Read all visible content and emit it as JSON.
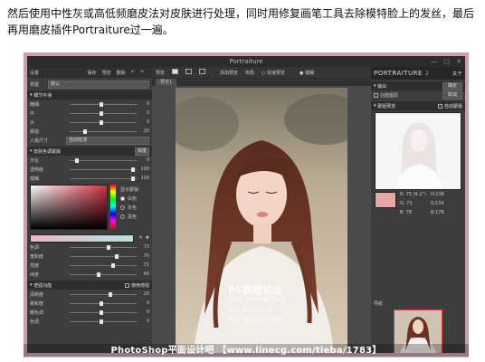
{
  "intro": {
    "line1": "然后使用中性灰或高低频磨皮法对皮肤进行处理，同时用修复画笔工具去除模特脸上的发丝，最后",
    "line2": "再用磨皮插件Portraiture过一遍。"
  },
  "window": {
    "title": "Portraiture",
    "controls": [
      "—",
      "□",
      "✕"
    ]
  },
  "left_panel": {
    "header": [
      "设置",
      "保存",
      "预览",
      "删除"
    ],
    "preset_label": "预置",
    "preset_value": "默认",
    "detail_section": "细节平滑",
    "detail_sliders": [
      {
        "label": "精细",
        "value": "0"
      },
      {
        "label": "中",
        "value": "0"
      },
      {
        "label": "大",
        "value": "0"
      },
      {
        "label": "阈值",
        "value": "20"
      }
    ],
    "portrait_size_label": "人像尺寸",
    "portrait_size_value": "自动检测",
    "mask_section": "皮肤色调蒙版",
    "mask_section_value": "高度",
    "mask_sliders": [
      {
        "label": "日化",
        "value": "0"
      },
      {
        "label": "透明度",
        "value": "100"
      },
      {
        "label": "模糊",
        "value": "100"
      }
    ],
    "display_mask": "显示蒙版",
    "mask_options": [
      "白色",
      "灰色",
      "黑色"
    ],
    "hue_sliders": [
      {
        "label": "色调",
        "value": "73"
      },
      {
        "label": "宽和度",
        "value": "70"
      },
      {
        "label": "亮度",
        "value": "71"
      },
      {
        "label": "纬度",
        "value": "40"
      }
    ],
    "enhance_section": "增强功能",
    "enhance_check": "使用增强",
    "enhance_sliders": [
      {
        "label": "清晰度",
        "value": "20"
      },
      {
        "label": "柔和度",
        "value": "0"
      },
      {
        "label": "暖色调",
        "value": "0"
      },
      {
        "label": "色调",
        "value": "0"
      }
    ]
  },
  "center_panel": {
    "toolbar": [
      "预览",
      "添加预览",
      "布局",
      "快速预览",
      "模糊"
    ],
    "tab": "预览1"
  },
  "photo": {
    "watermark": [
      "PS教程论坛",
      "学PS，就到PS教程论坛",
      "BBS.16XX8.COM",
      "作者：昵力元气三生画"
    ]
  },
  "right_panel": {
    "brand": "PORTRAITURE",
    "version": "2",
    "about": "关于",
    "output_label": "输出",
    "ok": "确定",
    "new_layer": "创建图层",
    "cancel": "取消",
    "mask_preview": "蒙版预览",
    "auto_mask": "自动蒙版",
    "readout": [
      "R: 75 (4.2°)",
      "H:238",
      "G: 73",
      "S:134",
      "B: 78",
      "B:178"
    ],
    "nav_label": "导航"
  },
  "caption": "PhotoShop平面设计吧 【www.linecg.com/tieba/1783】",
  "colors": {
    "frame": "#c9a0aa",
    "panel": "#3d3d3d",
    "skin_swatch": "#e8a9a6"
  }
}
